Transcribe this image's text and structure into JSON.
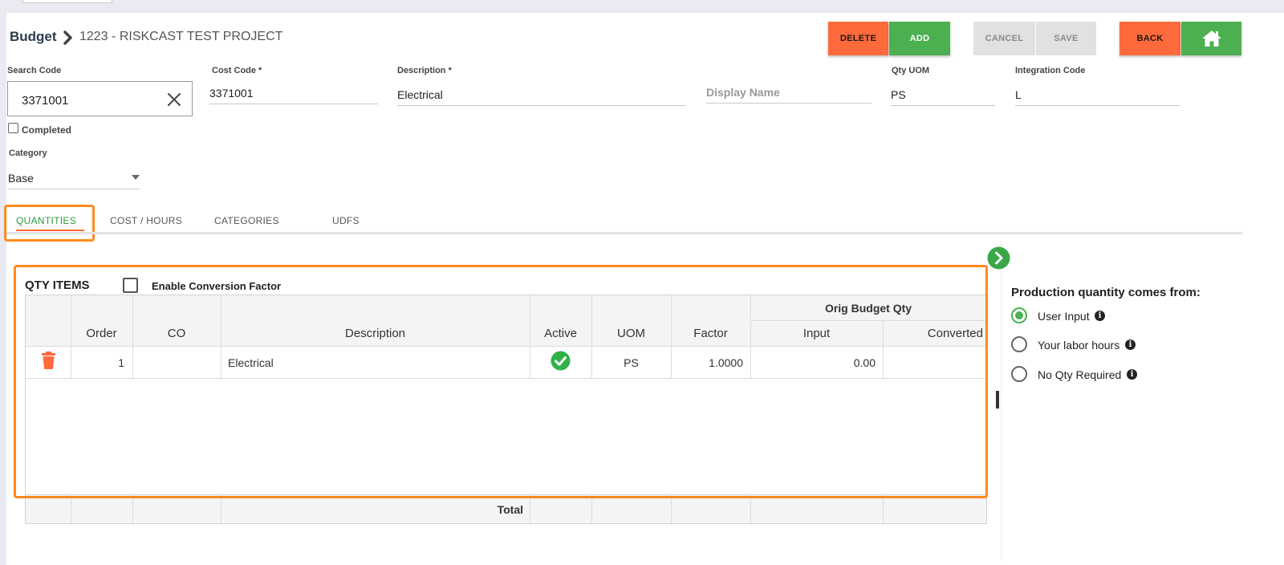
{
  "header": {
    "root": "Budget",
    "project": "1223 - RISKCAST TEST PROJECT"
  },
  "toolbar": {
    "delete": "DELETE",
    "add": "ADD",
    "cancel": "CANCEL",
    "save": "SAVE",
    "back": "BACK"
  },
  "form": {
    "search_code": {
      "label": "Search Code",
      "value": "3371001"
    },
    "cost_code": {
      "label": "Cost Code *",
      "value": "3371001"
    },
    "description": {
      "label": "Description *",
      "value": "Electrical"
    },
    "display_name": {
      "placeholder": "Display Name",
      "value": ""
    },
    "qty_uom": {
      "label": "Qty UOM",
      "value": "PS"
    },
    "integration_code": {
      "label": "Integration Code",
      "value": "L"
    },
    "completed_label": "Completed",
    "category": {
      "label": "Category",
      "value": "Base"
    }
  },
  "tabs": [
    {
      "label": "QUANTITIES"
    },
    {
      "label": "COST / HOURS"
    },
    {
      "label": "CATEGORIES"
    },
    {
      "label": "UDFS"
    }
  ],
  "qty": {
    "title": "QTY ITEMS",
    "conversion_label": "Enable Conversion Factor",
    "group_header": "Orig Budget Qty",
    "columns": {
      "order": "Order",
      "co": "CO",
      "description": "Description",
      "active": "Active",
      "uom": "UOM",
      "factor": "Factor",
      "input": "Input",
      "converted": "Converted"
    },
    "rows": [
      {
        "order": "1",
        "co": "",
        "description": "Electrical",
        "uom": "PS",
        "factor": "1.0000",
        "input": "0.00",
        "converted": ""
      }
    ],
    "total_label": "Total"
  },
  "production": {
    "title": "Production quantity comes from:",
    "options": [
      {
        "label": "User Input",
        "selected": true
      },
      {
        "label": "Your labor hours",
        "selected": false
      },
      {
        "label": "No Qty Required",
        "selected": false
      }
    ]
  },
  "colors": {
    "orange": "#ff6a3d",
    "green": "#4caf50",
    "highlight": "#ff8a1f"
  }
}
